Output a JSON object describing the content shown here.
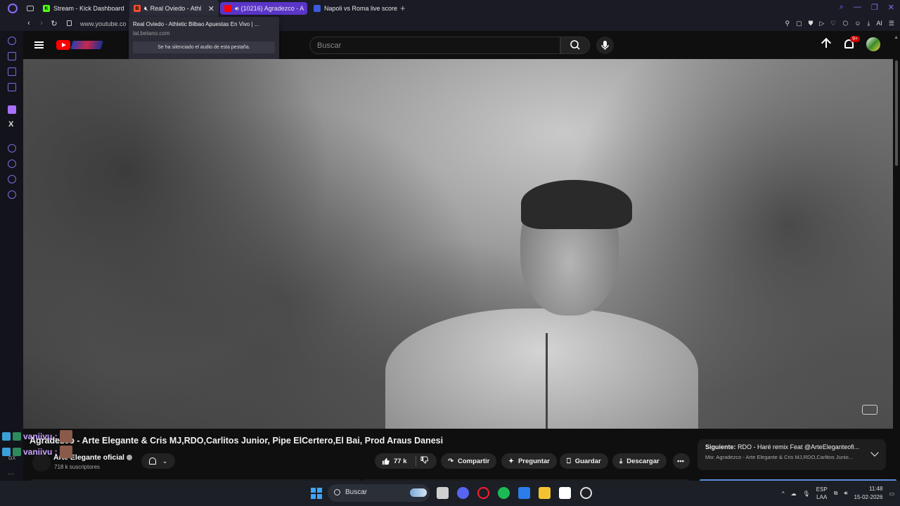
{
  "browser": {
    "tabs": [
      {
        "title": "Stream - Kick Dashboard",
        "favicon": "kick-icon",
        "color": "#53fc18"
      },
      {
        "title": "Real Oviedo - Athl",
        "favicon": "betano-icon",
        "color": "#ff4d2d",
        "muted": true
      },
      {
        "title": "(10216) Agradezco - A",
        "favicon": "youtube-icon",
        "color": "#ff0000",
        "active": true
      },
      {
        "title": "Napoli vs Roma live score",
        "favicon": "flashscore-icon",
        "color": "#3b5bdb"
      }
    ],
    "url": "www.youtube.co",
    "ai_label": "AI"
  },
  "tooltip": {
    "title": "Real Oviedo - Athletic Bilbao Apuestas En Vivo | ...",
    "domain": "lat.betano.com",
    "muted_note": "Se ha silenciado el audio de esta pestaña."
  },
  "youtube": {
    "search_placeholder": "Buscar",
    "notifications_badge": "9+"
  },
  "video": {
    "title": "Agradezco - Arte Elegante & Cris MJ,RDO,Carlitos Junior, Pipe ElCertero,El Bai, Prod Araus Danesi",
    "channel": "Arte Elegante oficial",
    "subscribers": "718 k suscriptores",
    "likes": "77 k",
    "actions": {
      "share": "Compartir",
      "ask": "Preguntar",
      "save": "Guardar",
      "download": "Descargar"
    }
  },
  "up_next": {
    "label": "Siguiente:",
    "title": "RDO - Haré remix Feat @ArteEleganteofi...",
    "mix": "Mix: Agradezco - Arte Elegante & Cris MJ,RDO,Carlitos Junio..."
  },
  "chat": [
    {
      "user": "vaniivu :"
    },
    {
      "user": "vaniivu :"
    }
  ],
  "chat_extra": {
    "gx": "GX",
    "dots": "···"
  },
  "taskbar": {
    "search": "Buscar",
    "lang_top": "ESP",
    "lang_bottom": "LAA",
    "time": "11:48",
    "date": "15-02-2026"
  }
}
